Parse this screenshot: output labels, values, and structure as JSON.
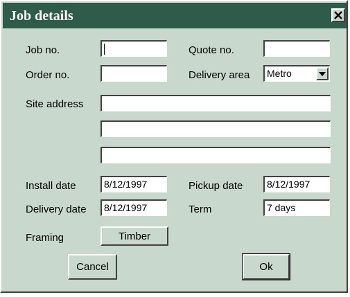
{
  "window": {
    "title": "Job details",
    "close_glyph": "✕"
  },
  "labels": {
    "job_no": "Job no.",
    "quote_no": "Quote no.",
    "order_no": "Order no.",
    "delivery_area": "Delivery area",
    "site_address": "Site address",
    "install_date": "Install date",
    "pickup_date": "Pickup date",
    "delivery_date": "Delivery date",
    "term": "Term",
    "framing": "Framing"
  },
  "fields": {
    "job_no": "",
    "quote_no": "",
    "order_no": "",
    "delivery_area": "Metro",
    "site_address_1": "",
    "site_address_2": "",
    "site_address_3": "",
    "install_date": "8/12/1997",
    "pickup_date": "8/12/1997",
    "delivery_date": "8/12/1997",
    "term": "7 days"
  },
  "buttons": {
    "framing": "Timber",
    "cancel": "Cancel",
    "ok": "Ok"
  },
  "colors": {
    "titlebar": "#2f5b4a",
    "face": "#c8d8cc"
  }
}
